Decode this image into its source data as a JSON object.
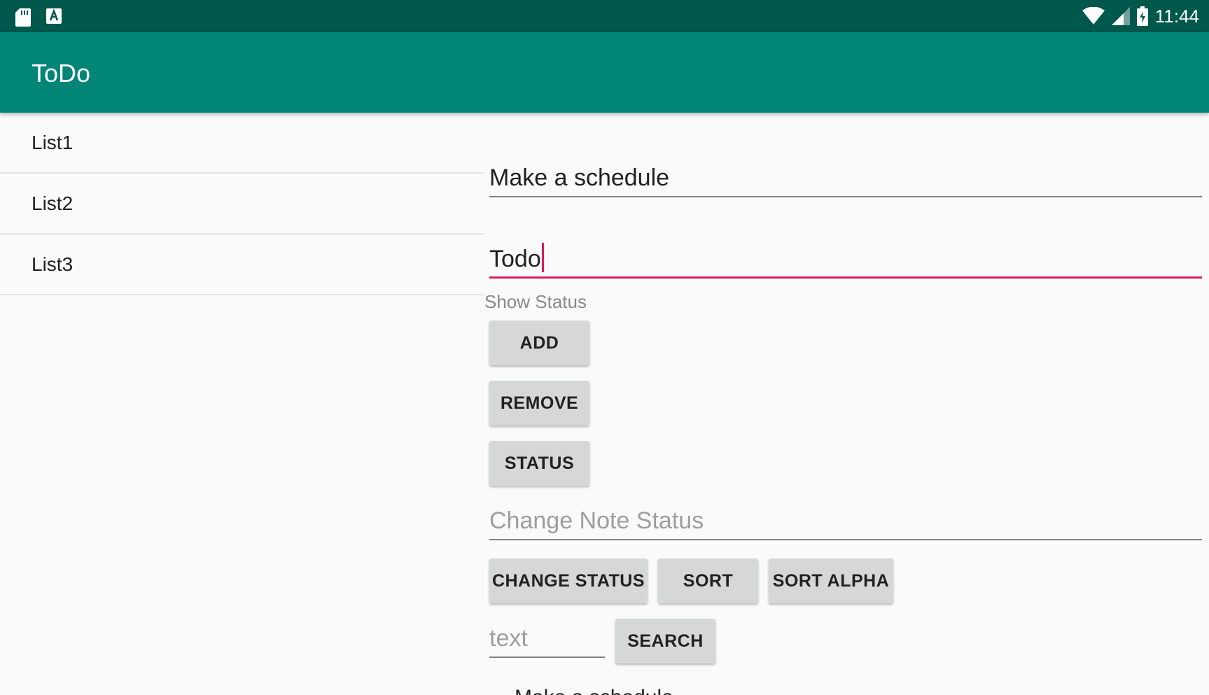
{
  "status_bar": {
    "time": "11:44",
    "left_icons": [
      "sd-card-icon",
      "app-notification-icon"
    ],
    "right_icons": [
      "wifi-icon",
      "cell-signal-icon",
      "battery-charging-icon"
    ]
  },
  "app_bar": {
    "title": "ToDo",
    "color": "#008577",
    "status_color": "#00574b"
  },
  "lists": [
    {
      "label": "List1"
    },
    {
      "label": "List2"
    },
    {
      "label": "List3"
    }
  ],
  "form": {
    "title_value": "Make a schedule",
    "note_value": "Todo",
    "show_status_label": "Show Status",
    "change_status_placeholder": "Change Note Status",
    "search_placeholder": "text",
    "accent_color": "#d81b60"
  },
  "buttons": {
    "add": "ADD",
    "remove": "REMOVE",
    "status": "STATUS",
    "change_status": "CHANGE STATUS",
    "sort": "SORT",
    "sort_alpha": "SORT ALPHA",
    "search": "SEARCH"
  },
  "results": {
    "first_item": "Make a schedule"
  }
}
